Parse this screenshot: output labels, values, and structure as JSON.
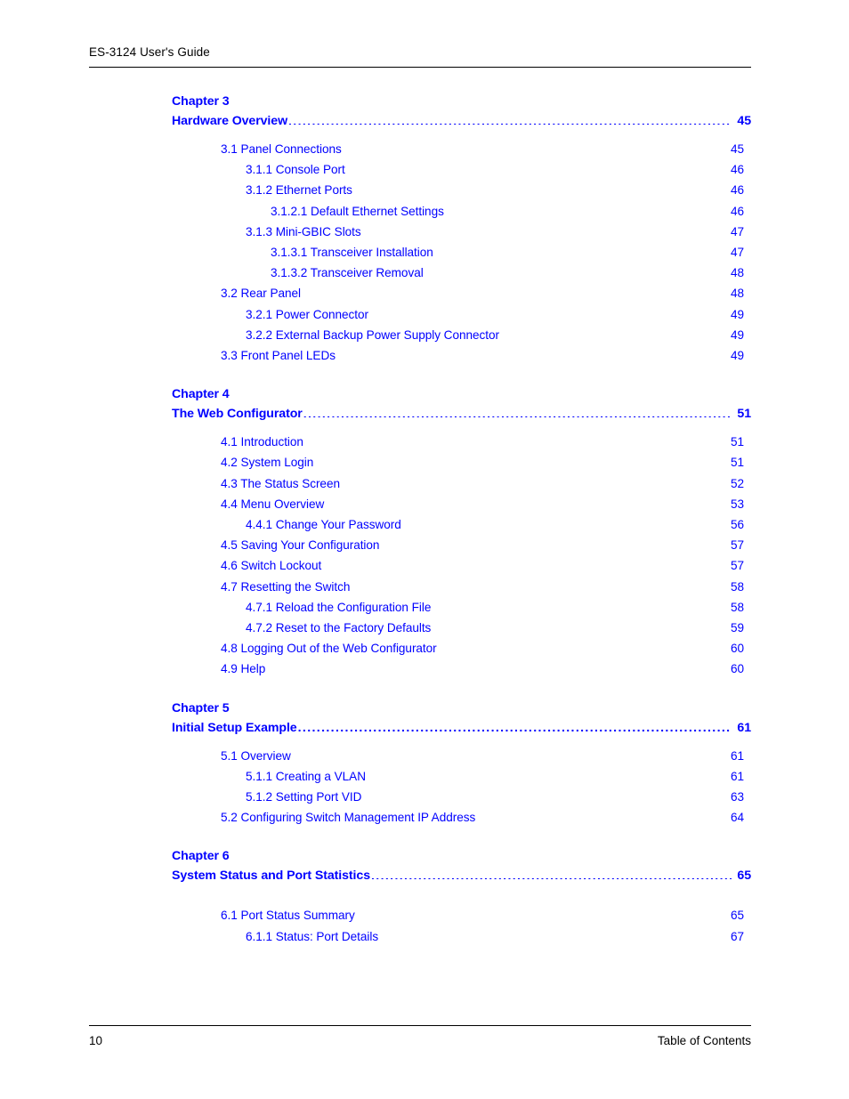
{
  "header": {
    "title": "ES-3124 User's Guide"
  },
  "footer": {
    "page_number": "10",
    "section_name": "Table of Contents"
  },
  "toc": {
    "chapters": [
      {
        "label": "Chapter 3",
        "title": "Hardware Overview",
        "page": "45",
        "entries": [
          {
            "level": 1,
            "text": "3.1 Panel Connections",
            "gap": "md",
            "page": "45"
          },
          {
            "level": 2,
            "text": "3.1.1 Console Port",
            "gap": "sm",
            "page": "46"
          },
          {
            "level": 2,
            "text": "3.1.2 Ethernet Ports",
            "gap": "sm",
            "page": "46"
          },
          {
            "level": 3,
            "text": "3.1.2.1 Default Ethernet Settings",
            "gap": "sm",
            "page": "46"
          },
          {
            "level": 2,
            "text": "3.1.3 Mini-GBIC Slots",
            "gap": "sm",
            "page": "47"
          },
          {
            "level": 3,
            "text": "3.1.3.1 Transceiver Installation",
            "gap": "md",
            "page": "47"
          },
          {
            "level": 3,
            "text": "3.1.3.2 Transceiver Removal",
            "gap": "md",
            "page": "48"
          },
          {
            "level": 1,
            "text": "3.2 Rear Panel",
            "gap": "sm",
            "page": "48"
          },
          {
            "level": 2,
            "text": "3.2.1 Power Connector",
            "gap": "sm",
            "page": "49"
          },
          {
            "level": 2,
            "text": "3.2.2 External Backup Power Supply Connector",
            "gap": "sm",
            "page": "49"
          },
          {
            "level": 1,
            "text": "3.3 Front Panel LEDs",
            "gap": "md",
            "page": "49"
          }
        ]
      },
      {
        "label": "Chapter 4",
        "title": "The Web Configurator",
        "page": "51",
        "entries": [
          {
            "level": 1,
            "text": "4.1 Introduction",
            "gap": "sm",
            "page": "51"
          },
          {
            "level": 1,
            "text": "4.2 System Login",
            "gap": "md",
            "page": "51"
          },
          {
            "level": 1,
            "text": "4.3 The Status Screen",
            "gap": "md",
            "page": "52"
          },
          {
            "level": 1,
            "text": "4.4 Menu Overview",
            "gap": "sm",
            "page": "53"
          },
          {
            "level": 2,
            "text": "4.4.1 Change Your Password",
            "gap": "md",
            "page": "56"
          },
          {
            "level": 1,
            "text": "4.5 Saving Your Configuration",
            "gap": "sm",
            "page": "57"
          },
          {
            "level": 1,
            "text": "4.6 Switch Lockout",
            "gap": "sm",
            "page": "57"
          },
          {
            "level": 1,
            "text": "4.7 Resetting the Switch",
            "gap": "md",
            "page": "58"
          },
          {
            "level": 2,
            "text": "4.7.1 Reload the Configuration File",
            "gap": "md",
            "page": "58"
          },
          {
            "level": 2,
            "text": "4.7.2 Reset to the Factory Defaults",
            "gap": "sm",
            "page": "59"
          },
          {
            "level": 1,
            "text": "4.8 Logging Out of the Web Configurator",
            "gap": "md",
            "page": "60"
          },
          {
            "level": 1,
            "text": "4.9 Help",
            "gap": "md",
            "page": "60"
          }
        ]
      },
      {
        "label": "Chapter 5",
        "title": "Initial Setup Example",
        "page": "61",
        "entries": [
          {
            "level": 1,
            "text": "5.1 Overview",
            "gap": "sm",
            "page": "61"
          },
          {
            "level": 2,
            "text": "5.1.1 Creating a VLAN",
            "gap": "sm",
            "page": "61"
          },
          {
            "level": 2,
            "text": "5.1.2 Setting Port VID",
            "gap": "sm",
            "page": "63"
          },
          {
            "level": 1,
            "text": "5.2 Configuring Switch Management IP Address",
            "gap": "sm",
            "page": "64"
          }
        ]
      },
      {
        "label": "Chapter 6",
        "title": "System Status and Port Statistics",
        "page": "65",
        "wide_entry_gap": true,
        "entries": [
          {
            "level": 1,
            "text": "6.1 Port Status Summary",
            "gap": "lg",
            "page": "65"
          },
          {
            "level": 2,
            "text": "6.1.1 Status: Port Details",
            "gap": "md",
            "page": "67"
          }
        ]
      }
    ]
  }
}
